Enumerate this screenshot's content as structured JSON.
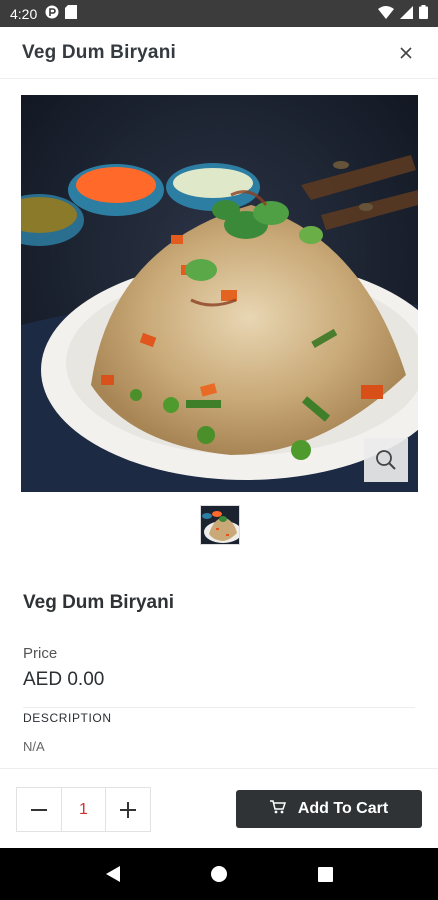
{
  "status_bar": {
    "time": "4:20",
    "icons": [
      "app-notification-icon",
      "sd-card-icon",
      "wifi-icon",
      "signal-icon",
      "battery-icon"
    ]
  },
  "header": {
    "title": "Veg Dum Biryani",
    "close_icon": "close-icon"
  },
  "product": {
    "image_icon": "zoom-icon",
    "name": "Veg Dum Biryani",
    "price_label": "Price",
    "price_value": "AED 0.00",
    "description_label": "DESCRIPTION",
    "description_value": "N/A"
  },
  "cart": {
    "quantity": "1",
    "add_label": "Add To Cart",
    "quantity_color": "#d0312d",
    "button_color": "#2f3336"
  },
  "nav": {
    "icons": [
      "back-icon",
      "home-icon",
      "recents-icon"
    ]
  }
}
